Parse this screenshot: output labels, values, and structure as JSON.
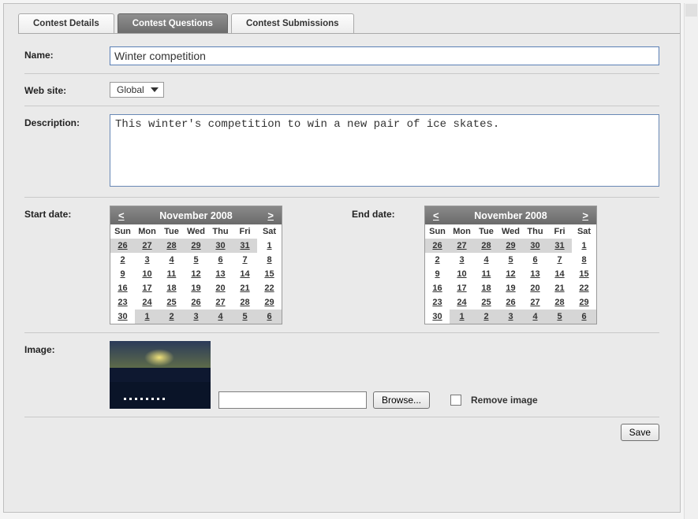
{
  "tabs": {
    "details": "Contest Details",
    "questions": "Contest Questions",
    "submissions": "Contest Submissions"
  },
  "labels": {
    "name": "Name:",
    "website": "Web site:",
    "description": "Description:",
    "start_date": "Start date:",
    "end_date": "End date:",
    "image": "Image:",
    "remove_image": "Remove image",
    "browse": "Browse...",
    "save": "Save"
  },
  "fields": {
    "name_value": "Winter competition",
    "website_value": "Global",
    "description_value": "This winter's competition to win a new pair of ice skates.",
    "file_path": ""
  },
  "calendar": {
    "prev": "<",
    "next": ">",
    "title": "November 2008",
    "dow": [
      "Sun",
      "Mon",
      "Tue",
      "Wed",
      "Thu",
      "Fri",
      "Sat"
    ],
    "weeks": [
      {
        "days": [
          {
            "n": "26",
            "out": true
          },
          {
            "n": "27",
            "out": true
          },
          {
            "n": "28",
            "out": true
          },
          {
            "n": "29",
            "out": true
          },
          {
            "n": "30",
            "out": true
          },
          {
            "n": "31",
            "out": true
          },
          {
            "n": "1",
            "out": false
          }
        ]
      },
      {
        "days": [
          {
            "n": "2",
            "out": false
          },
          {
            "n": "3",
            "out": false
          },
          {
            "n": "4",
            "out": false
          },
          {
            "n": "5",
            "out": false
          },
          {
            "n": "6",
            "out": false
          },
          {
            "n": "7",
            "out": false
          },
          {
            "n": "8",
            "out": false
          }
        ]
      },
      {
        "days": [
          {
            "n": "9",
            "out": false
          },
          {
            "n": "10",
            "out": false
          },
          {
            "n": "11",
            "out": false
          },
          {
            "n": "12",
            "out": false
          },
          {
            "n": "13",
            "out": false
          },
          {
            "n": "14",
            "out": false
          },
          {
            "n": "15",
            "out": false
          }
        ]
      },
      {
        "days": [
          {
            "n": "16",
            "out": false
          },
          {
            "n": "17",
            "out": false
          },
          {
            "n": "18",
            "out": false
          },
          {
            "n": "19",
            "out": false
          },
          {
            "n": "20",
            "out": false
          },
          {
            "n": "21",
            "out": false
          },
          {
            "n": "22",
            "out": false
          }
        ]
      },
      {
        "days": [
          {
            "n": "23",
            "out": false
          },
          {
            "n": "24",
            "out": false
          },
          {
            "n": "25",
            "out": false
          },
          {
            "n": "26",
            "out": false
          },
          {
            "n": "27",
            "out": false
          },
          {
            "n": "28",
            "out": false
          },
          {
            "n": "29",
            "out": false
          }
        ]
      },
      {
        "days": [
          {
            "n": "30",
            "out": false
          },
          {
            "n": "1",
            "out": true
          },
          {
            "n": "2",
            "out": true
          },
          {
            "n": "3",
            "out": true
          },
          {
            "n": "4",
            "out": true
          },
          {
            "n": "5",
            "out": true
          },
          {
            "n": "6",
            "out": true
          }
        ]
      }
    ]
  }
}
